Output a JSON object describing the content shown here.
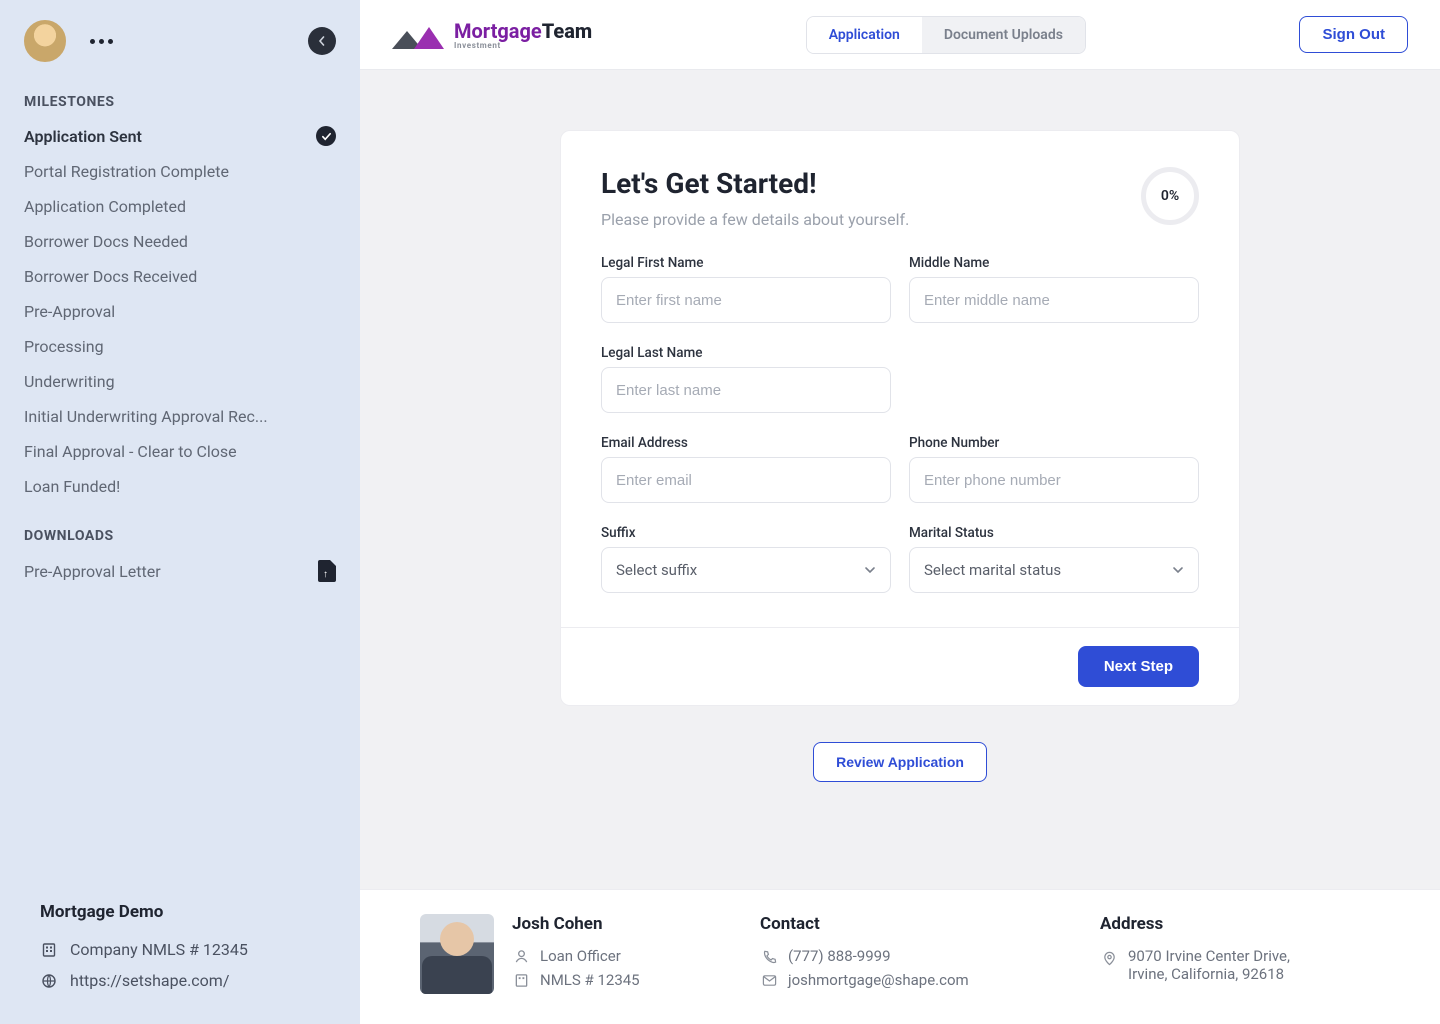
{
  "sidebar": {
    "milestones_title": "MILESTONES",
    "milestones": [
      {
        "label": "Application Sent",
        "done": true
      },
      {
        "label": "Portal Registration Complete",
        "done": false
      },
      {
        "label": "Application Completed",
        "done": false
      },
      {
        "label": "Borrower Docs Needed",
        "done": false
      },
      {
        "label": "Borrower Docs Received",
        "done": false
      },
      {
        "label": "Pre-Approval",
        "done": false
      },
      {
        "label": "Processing",
        "done": false
      },
      {
        "label": "Underwriting",
        "done": false
      },
      {
        "label": "Initial Underwriting Approval Rec...",
        "done": false
      },
      {
        "label": "Final Approval - Clear to Close",
        "done": false
      },
      {
        "label": "Loan Funded!",
        "done": false
      }
    ],
    "downloads_title": "DOWNLOADS",
    "downloads": [
      {
        "label": "Pre-Approval Letter"
      }
    ],
    "footer": {
      "company": "Mortgage Demo",
      "nmls": "Company NMLS # 12345",
      "url": "https://setshape.com/"
    }
  },
  "topbar": {
    "brand_mortgage": "Mortgage",
    "brand_team": "Team",
    "brand_sub": "Investment",
    "tabs": [
      {
        "label": "Application",
        "active": true
      },
      {
        "label": "Document Uploads",
        "active": false
      }
    ],
    "signout": "Sign Out"
  },
  "card": {
    "title": "Let's Get Started!",
    "subtitle": "Please provide a few details about yourself.",
    "progress": "0%",
    "fields": {
      "first_label": "Legal First Name",
      "first_ph": "Enter first name",
      "middle_label": "Middle Name",
      "middle_ph": "Enter middle name",
      "last_label": "Legal Last Name",
      "last_ph": "Enter last name",
      "email_label": "Email Address",
      "email_ph": "Enter email",
      "phone_label": "Phone Number",
      "phone_ph": "Enter phone number",
      "suffix_label": "Suffix",
      "suffix_ph": "Select suffix",
      "marital_label": "Marital Status",
      "marital_ph": "Select marital status"
    },
    "next": "Next Step",
    "review": "Review Application"
  },
  "infobar": {
    "officer_name": "Josh Cohen",
    "officer_role": "Loan Officer",
    "officer_nmls": "NMLS # 12345",
    "contact_title": "Contact",
    "phone": "(777) 888-9999",
    "email": "joshmortgage@shape.com",
    "address_title": "Address",
    "address_line1": "9070 Irvine Center Drive,",
    "address_line2": "Irvine, California, 92618"
  }
}
